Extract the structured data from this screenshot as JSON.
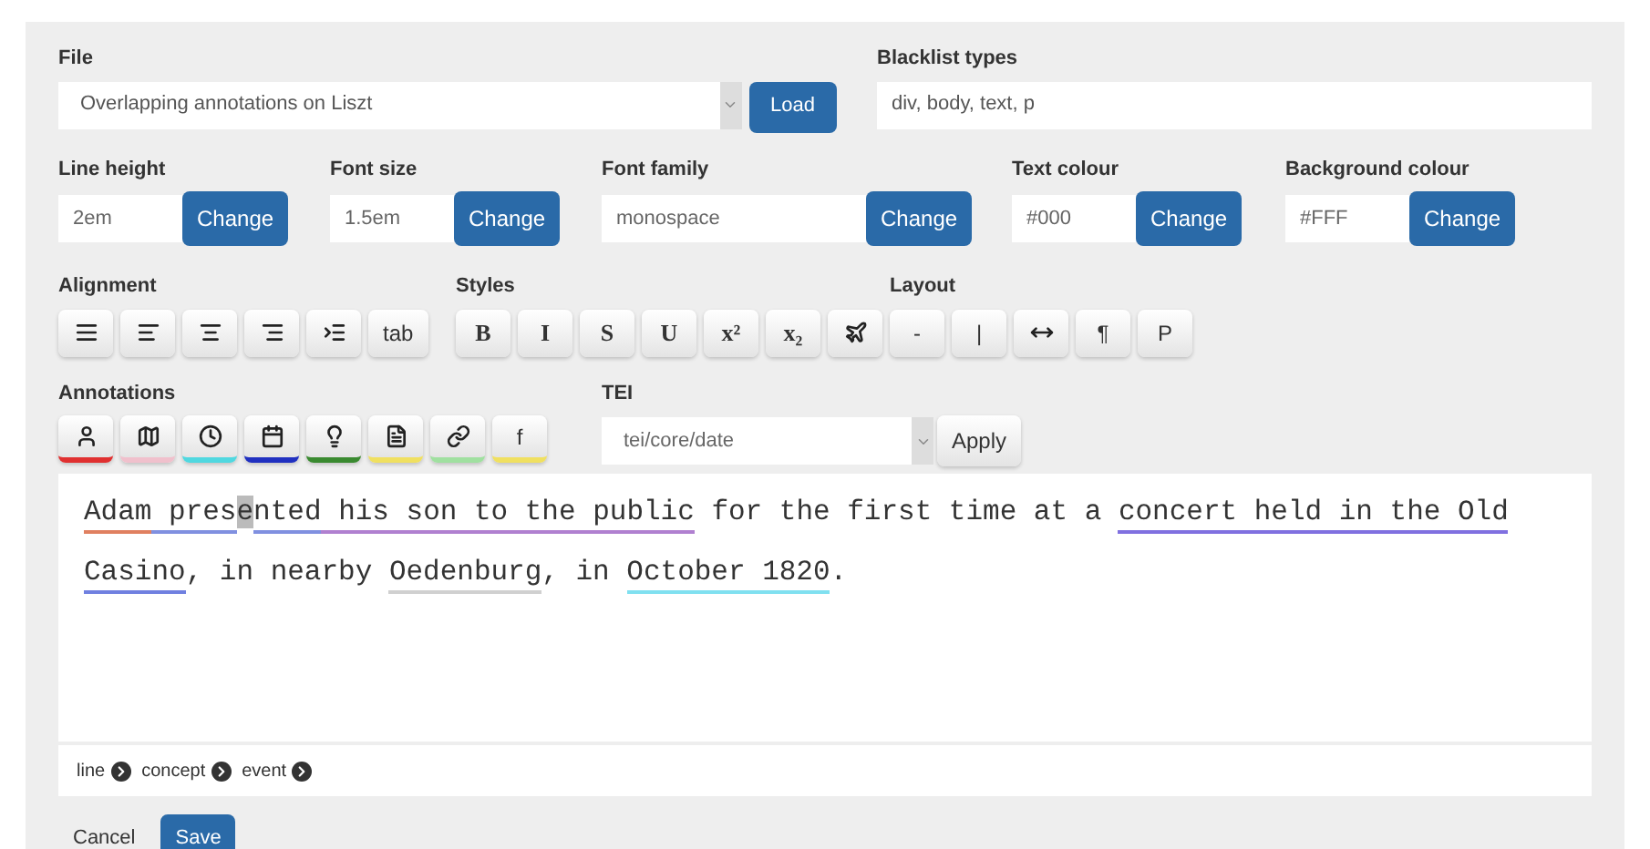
{
  "file": {
    "label": "File",
    "value": "Overlapping annotations on Liszt",
    "button": "Load"
  },
  "blacklist": {
    "label": "Blacklist types",
    "value": "div, body, text, p"
  },
  "settings": [
    {
      "label": "Line height",
      "value": "2em",
      "button": "Change"
    },
    {
      "label": "Font size",
      "value": "1.5em",
      "button": "Change"
    },
    {
      "label": "Font family",
      "value": "monospace",
      "button": "Change"
    },
    {
      "label": "Text colour",
      "value": "#000",
      "button": "Change"
    },
    {
      "label": "Background colour",
      "value": "#FFF",
      "button": "Change"
    }
  ],
  "alignment": {
    "label": "Alignment",
    "buttons": [
      {
        "kind": "icon"
      },
      {
        "kind": "icon"
      },
      {
        "kind": "icon"
      },
      {
        "kind": "icon"
      },
      {
        "kind": "icon"
      },
      {
        "kind": "text",
        "text": "tab"
      }
    ]
  },
  "styles": {
    "label": "Styles",
    "buttons": [
      {
        "kind": "text",
        "text": "B"
      },
      {
        "kind": "text",
        "text": "I"
      },
      {
        "kind": "text",
        "text": "S"
      },
      {
        "kind": "text",
        "text": "U"
      },
      {
        "kind": "text",
        "text": "x²"
      },
      {
        "kind": "text",
        "text": "x₂"
      },
      {
        "kind": "icon"
      }
    ]
  },
  "layout": {
    "label": "Layout",
    "buttons": [
      {
        "kind": "text",
        "text": "-"
      },
      {
        "kind": "text",
        "text": "|"
      },
      {
        "kind": "icon"
      },
      {
        "kind": "text",
        "text": "¶"
      },
      {
        "kind": "text",
        "text": "P"
      }
    ]
  },
  "annotations": {
    "label": "Annotations",
    "buttons": [
      {
        "kind": "icon",
        "color": "#e03030"
      },
      {
        "kind": "icon",
        "color": "#f0c0cc"
      },
      {
        "kind": "icon",
        "color": "#50d8e0"
      },
      {
        "kind": "icon",
        "color": "#2030c0"
      },
      {
        "kind": "icon",
        "color": "#3a8a30"
      },
      {
        "kind": "icon",
        "color": "#f0e060"
      },
      {
        "kind": "icon",
        "color": "#a0e0a0"
      },
      {
        "kind": "text",
        "text": "f",
        "color": "#f0e060"
      }
    ]
  },
  "tei": {
    "label": "TEI",
    "value": "tei/core/date",
    "button": "Apply"
  },
  "editor": {
    "lines": [
      [
        {
          "text": "Adam",
          "color": "#e08060"
        },
        {
          "text": " pres",
          "color": "#8090e0"
        },
        {
          "text": "e",
          "cursor": true
        },
        {
          "text": "nted",
          "color": "#8090e0"
        },
        {
          "text": " his son to the public",
          "color": "#b080d0"
        },
        {
          "text": " for the first time at a "
        },
        {
          "text": "concert held in the Old",
          "color": "#8070e0"
        }
      ],
      [
        {
          "text": "Casino",
          "color": "#7080e0"
        },
        {
          "text": ", in nearby "
        },
        {
          "text": "Oedenburg",
          "color": "#d0d0d0"
        },
        {
          "text": ", in "
        },
        {
          "text": "October 1820",
          "color": "#80e0f0"
        },
        {
          "text": "."
        }
      ]
    ]
  },
  "breadcrumb": [
    "line",
    "concept",
    "event"
  ],
  "actions": [
    {
      "text": "Cancel",
      "primary": false
    },
    {
      "text": "Save",
      "primary": true
    }
  ]
}
